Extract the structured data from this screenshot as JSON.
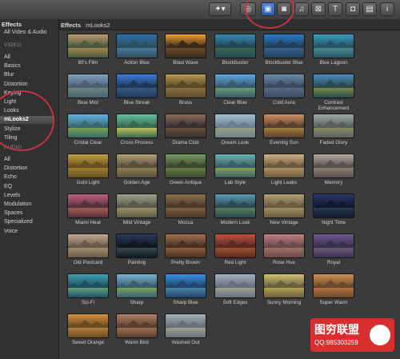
{
  "toolbar": {
    "buttons": [
      {
        "name": "magic-wand-menu-icon",
        "glyph": "✦▾"
      },
      {
        "name": "voiceover-icon",
        "glyph": "◎"
      },
      {
        "name": "effects-browser-icon",
        "glyph": "▣",
        "active": true
      },
      {
        "name": "photos-browser-icon",
        "glyph": "◙"
      },
      {
        "name": "music-browser-icon",
        "glyph": "♫"
      },
      {
        "name": "transitions-browser-icon",
        "glyph": "⊠"
      },
      {
        "name": "titles-browser-icon",
        "glyph": "T"
      },
      {
        "name": "generators-browser-icon",
        "glyph": "◘"
      },
      {
        "name": "themes-browser-icon",
        "glyph": "▤"
      },
      {
        "name": "inspector-icon",
        "glyph": "i"
      }
    ]
  },
  "sidebar": {
    "title": "Effects",
    "subtitle": "All Video & Audio",
    "video_heading": "VIDEO",
    "audio_heading": "AUDIO",
    "video_items": [
      "All",
      "Basics",
      "Blur",
      "Distortion",
      "Keying",
      "Light",
      "Looks",
      "mLooks2",
      "Stylize",
      "Tiling"
    ],
    "selected": "mLooks2",
    "audio_items": [
      "All",
      "Distortion",
      "Echo",
      "EQ",
      "Levels",
      "Modulation",
      "Spaces",
      "Specialized",
      "Voice"
    ]
  },
  "breadcrumb": {
    "label": "Effects",
    "current": "mLooks2"
  },
  "effects": [
    "80's Film",
    "Action Blue",
    "Blast Wave",
    "Blockbuster",
    "Blockbuster Blue",
    "Blue Lagoon",
    "Blue Mist",
    "Blue Streak",
    "Brass",
    "Clear Blue",
    "Cold Aura",
    "Contrast Enhancement",
    "Cristal Clear",
    "Cross Process",
    "Drama Club",
    "Dream Look",
    "Evening Sun",
    "Faded Glory",
    "Gold Light",
    "Golden Age",
    "Green Antique",
    "Lab Style",
    "Light Leaks",
    "Memory",
    "Miami Heat",
    "Mild Vintage",
    "Mocca",
    "Modern Look",
    "New Vintage",
    "Night Time",
    "Old Postcard",
    "Painting",
    "Pretty Brown",
    "Red Light",
    "Rose Hue",
    "Royal",
    "Sci-Fi",
    "Sharp",
    "Sharp Blue",
    "Soft Edges",
    "Sunny Morning",
    "Super Warm",
    "Sweet Orange",
    "Warm Bird",
    "Washed Out"
  ],
  "tints": [
    [
      "#b89a70",
      "#4a5a3a",
      "#a08850"
    ],
    [
      "#2d6fa8",
      "#2f5060",
      "#4a7a9a"
    ],
    [
      "#f0a030",
      "#3a2a1a",
      "#6a4a2a"
    ],
    [
      "#3a88b0",
      "#244858",
      "#3a6a50"
    ],
    [
      "#2a7ac8",
      "#20405a",
      "#3a6088"
    ],
    [
      "#3a9ab8",
      "#255565",
      "#4a8a8a"
    ],
    [
      "#7fa0c0",
      "#4a6070",
      "#6a8a80"
    ],
    [
      "#3a7ad8",
      "#203858",
      "#3a5a80"
    ],
    [
      "#b89a50",
      "#5a4a2a",
      "#8a7040"
    ],
    [
      "#5aa8e0",
      "#3a5a70",
      "#6a9a6a"
    ],
    [
      "#6a8aa8",
      "#3a4a60",
      "#5a6a80"
    ],
    [
      "#4a8ac0",
      "#2a4a50",
      "#7a8a40"
    ],
    [
      "#60b0e0",
      "#3a6a70",
      "#7aa050"
    ],
    [
      "#60c0a0",
      "#3a6a50",
      "#c0c060"
    ],
    [
      "#8a6a5a",
      "#3a3030",
      "#6a5040"
    ],
    [
      "#a0c0d0",
      "#6a8090",
      "#9aa080"
    ],
    [
      "#d09060",
      "#5a4030",
      "#a08040"
    ],
    [
      "#9aa8a0",
      "#5a6060",
      "#8a8a60"
    ],
    [
      "#c0a040",
      "#6a5020",
      "#9a8030"
    ],
    [
      "#b0a070",
      "#5a5040",
      "#8a8050"
    ],
    [
      "#7a9a60",
      "#3a4a30",
      "#6a7a40"
    ],
    [
      "#6ab0b0",
      "#3a6060",
      "#8aa060"
    ],
    [
      "#d0b080",
      "#6a5a40",
      "#b09060"
    ],
    [
      "#b0a8a0",
      "#5a5050",
      "#8a8070"
    ],
    [
      "#c06080",
      "#5a3040",
      "#a06050"
    ],
    [
      "#a0a090",
      "#5a5a4a",
      "#9a9060"
    ],
    [
      "#8a7050",
      "#4a3a2a",
      "#7a6040"
    ],
    [
      "#5a9ab0",
      "#2a4a58",
      "#5a8050"
    ],
    [
      "#b0a070",
      "#6a5a40",
      "#a09060"
    ],
    [
      "#2a3a6a",
      "#101830",
      "#2a3a50"
    ],
    [
      "#c0a890",
      "#6a5a4a",
      "#a09070"
    ],
    [
      "#2a3a5a",
      "#101820",
      "#3a4a50"
    ],
    [
      "#a07050",
      "#4a3020",
      "#8a6040"
    ],
    [
      "#c05040",
      "#5a2a20",
      "#a05030"
    ],
    [
      "#c08080",
      "#6a4a4a",
      "#a07060"
    ],
    [
      "#6a5a90",
      "#3a3050",
      "#6a5a70"
    ],
    [
      "#40a0b0",
      "#205060",
      "#60a080"
    ],
    [
      "#7ab0d0",
      "#3a6070",
      "#7aa060"
    ],
    [
      "#3a90e0",
      "#204870",
      "#4a80a0"
    ],
    [
      "#a0b0c0",
      "#6a7080",
      "#9aa090"
    ],
    [
      "#d0c070",
      "#6a6040",
      "#b0a050"
    ],
    [
      "#d09050",
      "#6a4a2a",
      "#b07040"
    ],
    [
      "#d09040",
      "#6a4a20",
      "#b08040"
    ],
    [
      "#b08060",
      "#5a4030",
      "#9a7050"
    ],
    [
      "#a0b0b8",
      "#6a7078",
      "#9aa090"
    ]
  ],
  "watermark": {
    "title": "图穷联盟",
    "sub": "QQ:985303259"
  }
}
